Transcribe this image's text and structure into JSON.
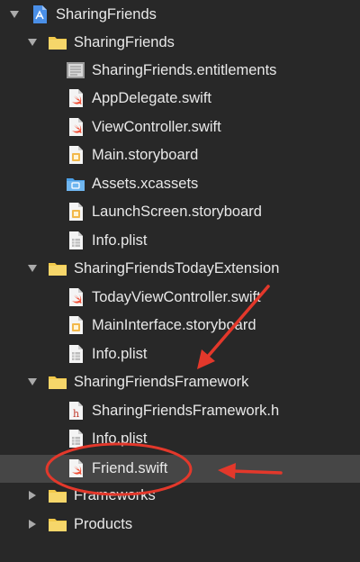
{
  "navigator": {
    "items": [
      {
        "label": "SharingFriends",
        "icon": "xcode-project-icon",
        "kind": "project",
        "disclosure": "expanded"
      },
      {
        "label": "SharingFriends",
        "icon": "folder-icon",
        "kind": "group",
        "disclosure": "expanded"
      },
      {
        "label": "SharingFriends.entitlements",
        "icon": "entitlements-file-icon",
        "kind": "file"
      },
      {
        "label": "AppDelegate.swift",
        "icon": "swift-file-icon",
        "kind": "file"
      },
      {
        "label": "ViewController.swift",
        "icon": "swift-file-icon",
        "kind": "file"
      },
      {
        "label": "Main.storyboard",
        "icon": "storyboard-file-icon",
        "kind": "file"
      },
      {
        "label": "Assets.xcassets",
        "icon": "asset-catalog-icon",
        "kind": "file"
      },
      {
        "label": "LaunchScreen.storyboard",
        "icon": "storyboard-file-icon",
        "kind": "file"
      },
      {
        "label": "Info.plist",
        "icon": "plist-file-icon",
        "kind": "file"
      },
      {
        "label": "SharingFriendsTodayExtension",
        "icon": "folder-icon",
        "kind": "group",
        "disclosure": "expanded"
      },
      {
        "label": "TodayViewController.swift",
        "icon": "swift-file-icon",
        "kind": "file"
      },
      {
        "label": "MainInterface.storyboard",
        "icon": "storyboard-file-icon",
        "kind": "file"
      },
      {
        "label": "Info.plist",
        "icon": "plist-file-icon",
        "kind": "file"
      },
      {
        "label": "SharingFriendsFramework",
        "icon": "folder-icon",
        "kind": "group",
        "disclosure": "expanded"
      },
      {
        "label": "SharingFriendsFramework.h",
        "icon": "header-file-icon",
        "kind": "file"
      },
      {
        "label": "Info.plist",
        "icon": "plist-file-icon",
        "kind": "file"
      },
      {
        "label": "Friend.swift",
        "icon": "swift-file-icon",
        "kind": "file",
        "selected": true
      },
      {
        "label": "Frameworks",
        "icon": "folder-icon",
        "kind": "group",
        "disclosure": "collapsed"
      },
      {
        "label": "Products",
        "icon": "folder-icon",
        "kind": "group",
        "disclosure": "collapsed"
      }
    ]
  },
  "colors": {
    "background": "#282828",
    "selected_row": "#464646",
    "text": "#e8e8e8",
    "folder": "#f2c94a",
    "swift": "#f05138",
    "project_blue": "#4a8fe7",
    "annotation_red": "#e3382b"
  }
}
